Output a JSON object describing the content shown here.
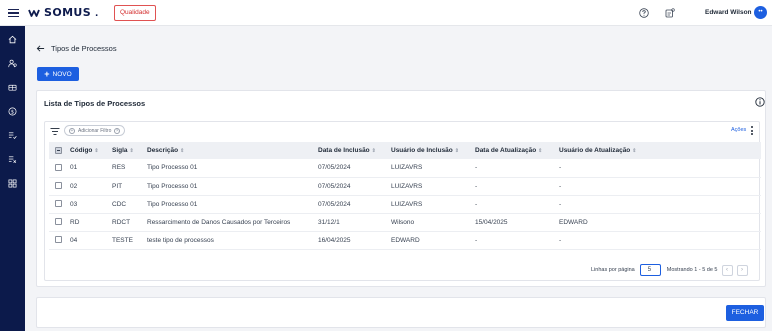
{
  "topbar": {
    "logo_text": "SOMUS",
    "logo_dot": ".",
    "env_badge": "Qualidade",
    "user_name": "Edward Wilson",
    "avatar_initials": "••",
    "icons": [
      "help-icon",
      "notification-settings-icon"
    ]
  },
  "sidebar": {
    "items": [
      "home-icon",
      "people-icon",
      "wallet-icon",
      "money-icon",
      "document-list-icon",
      "checklist-icon",
      "grid-icon"
    ]
  },
  "header": {
    "title": "Tipos de Processos",
    "new_button": "NOVO"
  },
  "panel": {
    "title": "Lista de Tipos de Processos",
    "filter_chip": "Adicionar Filtro",
    "actions_label": "Ações",
    "columns": [
      "Código",
      "Sigla",
      "Descrição",
      "Data de Inclusão",
      "Usuário de Inclusão",
      "Data de Atualização",
      "Usuário de Atualização"
    ],
    "rows": [
      [
        "01",
        "RES",
        "Tipo Processo 01",
        "07/05/2024",
        "LUIZAVRS",
        "-",
        "-"
      ],
      [
        "02",
        "PIT",
        "Tipo Processo 01",
        "07/05/2024",
        "LUIZAVRS",
        "-",
        "-"
      ],
      [
        "03",
        "CDC",
        "Tipo Processo 01",
        "07/05/2024",
        "LUIZAVRS",
        "-",
        "-"
      ],
      [
        "RD",
        "RDCT",
        "Ressarcimento de Danos Causados por Terceiros",
        "31/12/1",
        "Wilsono",
        "15/04/2025",
        "EDWARD"
      ],
      [
        "04",
        "TESTE",
        "teste tipo de processos",
        "16/04/2025",
        "EDWARD",
        "-",
        "-"
      ]
    ],
    "pagination": {
      "rows_per_page_label": "Linhas por página",
      "rows_per_page": "5",
      "range": "Mostrando 1 - 5 de 5",
      "prev": "‹",
      "next": "›"
    }
  },
  "footer": {
    "close_button": "FECHAR"
  },
  "colors": {
    "sidebar_bg": "#0c1a4b",
    "primary": "#1d5fe0",
    "badge_red": "#d32f2f"
  }
}
